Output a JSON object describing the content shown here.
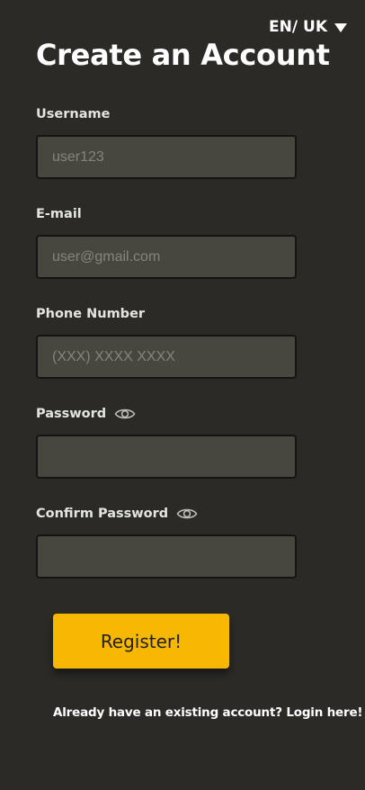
{
  "language": {
    "selected": "EN/ UK",
    "caret_icon": "caret-down-icon"
  },
  "title": "Create an Account",
  "form": {
    "username": {
      "label": "Username",
      "placeholder": "user123",
      "value": ""
    },
    "email": {
      "label": "E-mail",
      "placeholder": "user@gmail.com",
      "value": ""
    },
    "phone": {
      "label": "Phone Number",
      "placeholder": "(XXX) XXXX XXXX",
      "value": ""
    },
    "password": {
      "label": "Password",
      "placeholder": "",
      "value": "",
      "toggle_icon": "eye-icon"
    },
    "confirm_password": {
      "label": "Confirm Password",
      "placeholder": "",
      "value": "",
      "toggle_icon": "eye-icon"
    }
  },
  "register_button": "Register!",
  "login_prompt": {
    "text": "Already have an existing account?",
    "link": "Login here!"
  },
  "colors": {
    "background": "#2b2a27",
    "input_background": "#48473f",
    "input_border": "#141413",
    "accent": "#f8b702",
    "text": "#ffffff"
  }
}
